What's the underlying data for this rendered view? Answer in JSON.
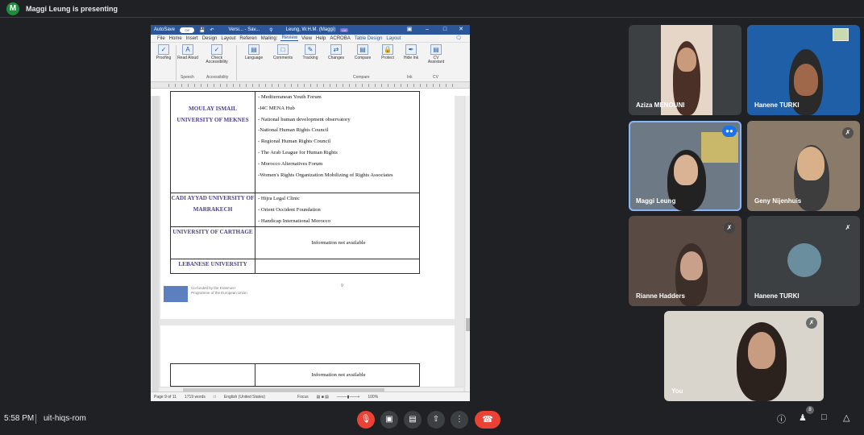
{
  "meeting": {
    "presenter_initial": "M",
    "presenter_text": "Maggi Leung is presenting",
    "time": "5:58 PM",
    "code": "uit-hiqs-rom",
    "participant_count": "8"
  },
  "word": {
    "autosave": "AutoSave",
    "autosave_state": "Off",
    "doc_name": "Versi... - Sav...",
    "user": "Leung, W.H.M. (Maggi)",
    "user_initials": "LW",
    "menu": [
      "File",
      "Home",
      "Insert",
      "Design",
      "Layout",
      "Referen",
      "Mailing:",
      "Review",
      "View",
      "Help",
      "ACROBA",
      "Table Design",
      "Layout"
    ],
    "ribbon": {
      "proofing": "Proofing",
      "read_aloud": "Read Aloud",
      "check_accessibility": "Check Accessibility",
      "language": "Language",
      "comments": "Comments",
      "tracking": "Tracking",
      "changes": "Changes",
      "compare": "Compare",
      "protect": "Protect",
      "hide_ink": "Hide Ink",
      "cv_assistant": "CV Assistant",
      "group_speech": "Speech",
      "group_accessibility": "Accessibility",
      "group_compare": "Compare",
      "group_ink": "Ink",
      "group_cv": "CV"
    },
    "table": {
      "rows": [
        {
          "university": "MOULAY ISMAIL UNIVERSITY OF MEKNES",
          "items": [
            "- Mediterranean Youth Forum",
            "-I4C MENA Hub",
            "- National human development observatory",
            "-National Human Rights Council",
            "- Regional Human Rights Council",
            "- The Arab League for Human Rights",
            "- Morocco Alternatives Forum",
            "-Women's Rights Organization Mobilizing of Rights Associates"
          ]
        },
        {
          "university": "CADI AYYAD UNIVERSITY OF MARRAKECH",
          "items": [
            "- Hijra Legal Clinic",
            "- Orient Occident Foundation",
            "- Handicap International Morocco"
          ]
        },
        {
          "university": "UNIVERSITY OF CARTHAGE",
          "items": [
            "Information not available"
          ]
        },
        {
          "university": "LEBANESE UNIVERSITY",
          "items": [
            ""
          ]
        }
      ],
      "page2_row": "Information not available",
      "page_number": "9"
    },
    "footer_text": "Co-funded by the Erasmus+ Programme of the European Union",
    "status": {
      "page": "Page 9 of 11",
      "words": "1719 words",
      "language": "English (United States)",
      "focus": "Focus",
      "zoom": "100%"
    }
  },
  "participants": [
    {
      "name": "Aziza MENOUNI",
      "muted": false
    },
    {
      "name": "Hanene TURKI",
      "muted": false
    },
    {
      "name": "Maggi Leung",
      "muted": false,
      "speaking": true
    },
    {
      "name": "Geny Nijenhuis",
      "muted": true
    },
    {
      "name": "Rianne Hadders",
      "muted": true
    },
    {
      "name": "Hanene TURKI",
      "muted": true
    },
    {
      "name": "You",
      "muted": true
    }
  ]
}
